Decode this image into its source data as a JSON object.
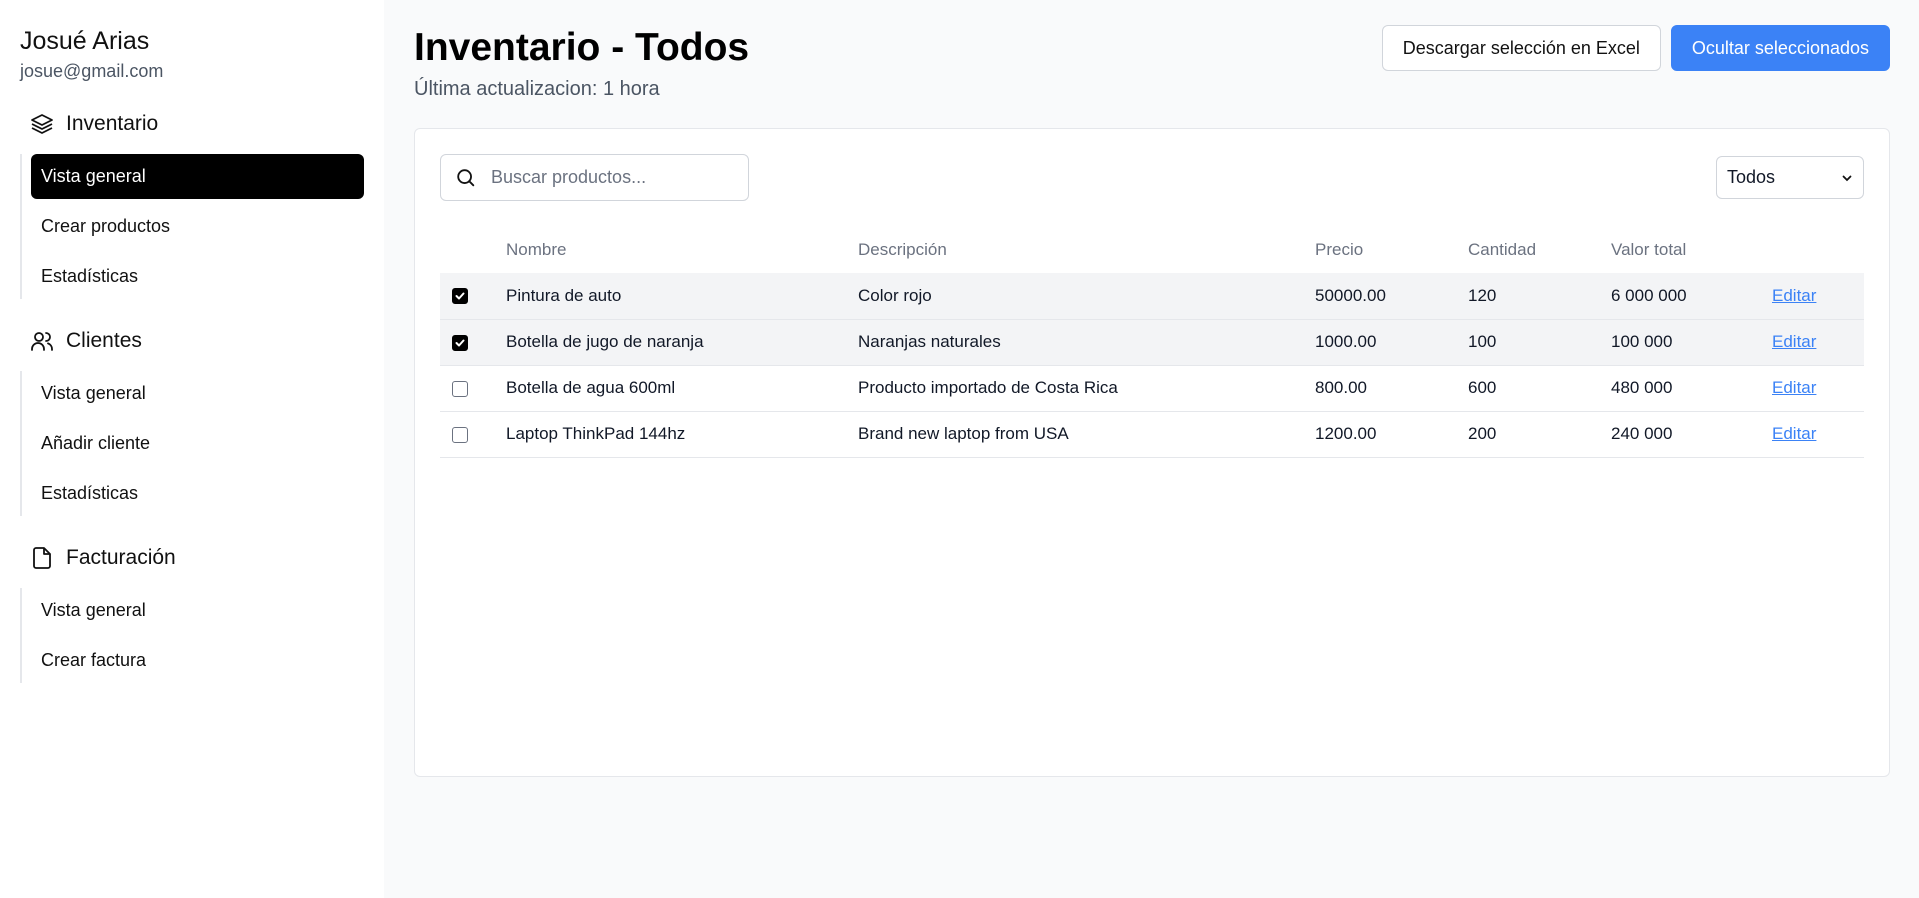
{
  "user": {
    "name": "Josué Arias",
    "email": "josue@gmail.com"
  },
  "sidebar": {
    "sections": [
      {
        "title": "Inventario",
        "icon": "layers-icon",
        "items": [
          "Vista general",
          "Crear productos",
          "Estadísticas"
        ],
        "active_index": 0
      },
      {
        "title": "Clientes",
        "icon": "users-icon",
        "items": [
          "Vista general",
          "Añadir cliente",
          "Estadísticas"
        ]
      },
      {
        "title": "Facturación",
        "icon": "file-icon",
        "items": [
          "Vista general",
          "Crear factura"
        ]
      }
    ]
  },
  "header": {
    "title": "Inventario - Todos",
    "subtitle": "Última actualizacion: 1 hora",
    "download_label": "Descargar selección en Excel",
    "hide_label": "Ocultar seleccionados"
  },
  "search": {
    "placeholder": "Buscar productos..."
  },
  "filter": {
    "selected": "Todos"
  },
  "table": {
    "columns": [
      "Nombre",
      "Descripción",
      "Precio",
      "Cantidad",
      "Valor total"
    ],
    "rows": [
      {
        "checked": true,
        "nombre": "Pintura de auto",
        "descripcion": "Color rojo",
        "precio": "50000.00",
        "cantidad": "120",
        "valor_total": "6 000 000",
        "action": "Editar"
      },
      {
        "checked": true,
        "nombre": "Botella de jugo de naranja",
        "descripcion": "Naranjas naturales",
        "precio": "1000.00",
        "cantidad": "100",
        "valor_total": "100 000",
        "action": "Editar"
      },
      {
        "checked": false,
        "nombre": "Botella de agua 600ml",
        "descripcion": "Producto importado de Costa Rica",
        "precio": "800.00",
        "cantidad": "600",
        "valor_total": "480 000",
        "action": "Editar"
      },
      {
        "checked": false,
        "nombre": "Laptop ThinkPad 144hz",
        "descripcion": "Brand new laptop from USA",
        "precio": "1200.00",
        "cantidad": "200",
        "valor_total": "240 000",
        "action": "Editar"
      }
    ]
  },
  "colors": {
    "primary": "#3b82f6",
    "active_nav": "#000000",
    "selected_row": "#f3f4f6"
  }
}
